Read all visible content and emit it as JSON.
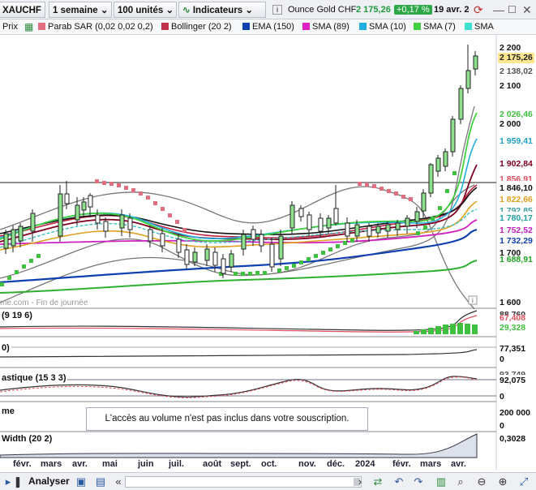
{
  "toolbar": {
    "symbol": "XAUCHF",
    "period": "1 semaine",
    "units": "100 unités",
    "indicators": "Indicateurs",
    "info_icon": "i",
    "instrument": "Ounce Gold CHF",
    "price": "2 175,26",
    "change": "+0,17 %",
    "date": "19 avr. 2("
  },
  "legend": {
    "prix": "Prix",
    "items": [
      {
        "label": "Parab SAR (0,02 0,02 0,2)",
        "color": "#e07080"
      },
      {
        "label": "Bollinger (20 2)",
        "color": "#c0304a"
      },
      {
        "label": "EMA (150)",
        "color": "#1040b0"
      },
      {
        "label": "SMA (89)",
        "color": "#e020c0"
      },
      {
        "label": "SMA (10)",
        "color": "#20b0e0"
      },
      {
        "label": "SMA (7)",
        "color": "#40d040"
      },
      {
        "label": "SMA",
        "color": "#40e0d0"
      }
    ]
  },
  "price_axis": [
    "2 200",
    "2 100",
    "2 000",
    "1 600"
  ],
  "price_axis_extra": "1 700",
  "price_tags": [
    {
      "value": "2 175,26",
      "bg": "#ffe890",
      "color": "#222"
    },
    {
      "value": "2 138,02",
      "bg": "#fff",
      "color": "#555"
    },
    {
      "value": "2 026,46",
      "bg": "#fff",
      "color": "#40c040"
    },
    {
      "value": "1 959,41",
      "bg": "#fff",
      "color": "#20a0c0"
    },
    {
      "value": "1 902,84",
      "bg": "#fff",
      "color": "#800020"
    },
    {
      "value": "1 856,91",
      "bg": "#fff",
      "color": "#e05060"
    },
    {
      "value": "1 846,10",
      "bg": "#fff",
      "color": "#111"
    },
    {
      "value": "1 822,66",
      "bg": "#fff",
      "color": "#e0a020"
    },
    {
      "value": "1 792,85",
      "bg": "#fff",
      "color": "#40a0a0"
    },
    {
      "value": "1 780,17",
      "bg": "#fff",
      "color": "#20a0a0"
    },
    {
      "value": "1 752,52",
      "bg": "#fff",
      "color": "#c020c0"
    },
    {
      "value": "1 732,29",
      "bg": "#fff",
      "color": "#1040b0"
    },
    {
      "value": "1 688,91",
      "bg": "#fff",
      "color": "#20a020"
    }
  ],
  "watermark": "me.com - Fin de journée",
  "panels": {
    "macd_title": "(9 19 6)",
    "macd_values": [
      "88,760",
      "67,408",
      "29,328"
    ],
    "macd_colors": [
      "#333",
      "#e05060",
      "#40c040"
    ],
    "p2_title": "0)",
    "p2_value": "77,351",
    "p2_zero": "0",
    "stoch_title": "astique (15 3 3)",
    "stoch_values": [
      "93,749",
      "92,075",
      "0"
    ],
    "vol_title": "me",
    "vol_axis": [
      "200 000",
      "0"
    ],
    "vol_message": "L'accès au volume n'est pas inclus dans votre souscription.",
    "bw_title": "Width (20 2)",
    "bw_value": "0,3028"
  },
  "x_axis": [
    "févr.",
    "mars",
    "avr.",
    "mai",
    "juin",
    "juil.",
    "août",
    "sept.",
    "oct.",
    "nov.",
    "déc.",
    "2024",
    "févr.",
    "mars",
    "avr."
  ],
  "bottombar": {
    "analyser": "Analyser"
  }
}
